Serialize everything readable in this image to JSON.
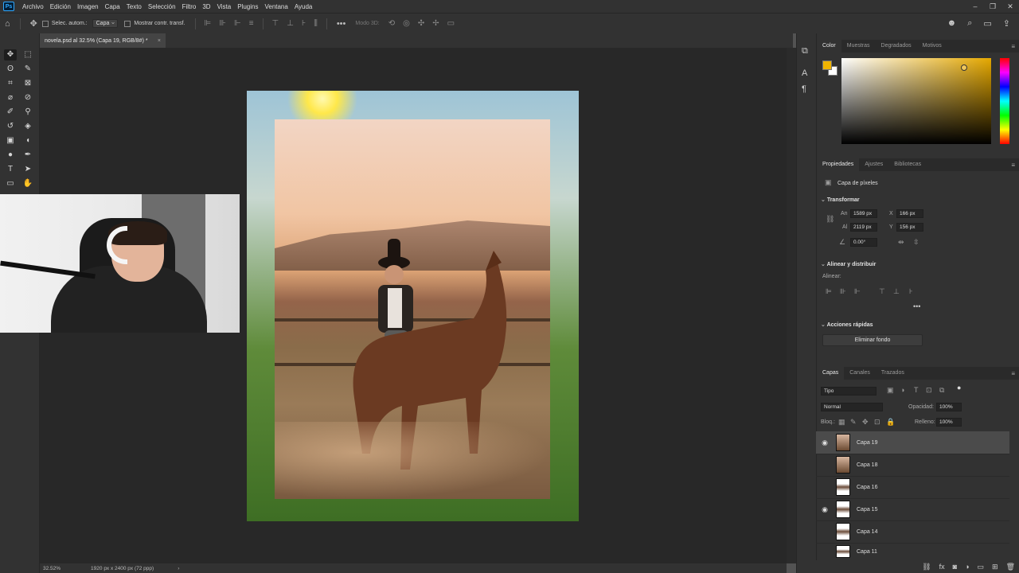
{
  "menubar": {
    "logo": "Ps",
    "items": [
      "Archivo",
      "Edición",
      "Imagen",
      "Capa",
      "Texto",
      "Selección",
      "Filtro",
      "3D",
      "Vista",
      "Plugins",
      "Ventana",
      "Ayuda"
    ],
    "window_controls": [
      "–",
      "❐",
      "✕"
    ]
  },
  "options": {
    "auto_select_label": "Selec. autom.:",
    "auto_select_value": "Capa",
    "transform_label": "Mostrar contr. transf.",
    "mode_3d": "Modo 3D:"
  },
  "document": {
    "tab_title": "novela.psd al 32.5% (Capa 19, RGB/8#) *",
    "zoom": "32.52%",
    "size_info": "1920 px x 2400 px (72 ppp)"
  },
  "color_panel": {
    "tabs": [
      "Color",
      "Muestras",
      "Degradados",
      "Motivos"
    ],
    "foreground": "#f0b400",
    "background": "#ffffff"
  },
  "properties_panel": {
    "tabs": [
      "Propiedades",
      "Ajustes",
      "Bibliotecas"
    ],
    "layer_type": "Capa de píxeles",
    "transform_title": "Transformar",
    "width_label": "An",
    "width_value": "1589 px",
    "height_label": "Al",
    "height_value": "2119 px",
    "x_label": "X",
    "x_value": "166 px",
    "y_label": "Y",
    "y_value": "156 px",
    "angle_value": "0.00°",
    "align_title": "Alinear y distribuir",
    "align_label": "Alinear:",
    "quick_actions_title": "Acciones rápidas",
    "remove_bg": "Eliminar fondo"
  },
  "layers_panel": {
    "tabs": [
      "Capas",
      "Canales",
      "Trazados"
    ],
    "filter_kind": "Tipo",
    "blend_mode": "Normal",
    "opacity_label": "Opacidad:",
    "opacity_value": "100%",
    "lock_label": "Bloq.:",
    "fill_label": "Relleno:",
    "fill_value": "100%",
    "layers": [
      {
        "name": "Capa 19",
        "visible": true,
        "selected": true
      },
      {
        "name": "Capa 18",
        "visible": false,
        "selected": false
      },
      {
        "name": "Capa 16",
        "visible": false,
        "selected": false
      },
      {
        "name": "Capa 15",
        "visible": true,
        "selected": false
      },
      {
        "name": "Capa 14",
        "visible": false,
        "selected": false
      },
      {
        "name": "Capa 11",
        "visible": false,
        "selected": false
      }
    ]
  }
}
